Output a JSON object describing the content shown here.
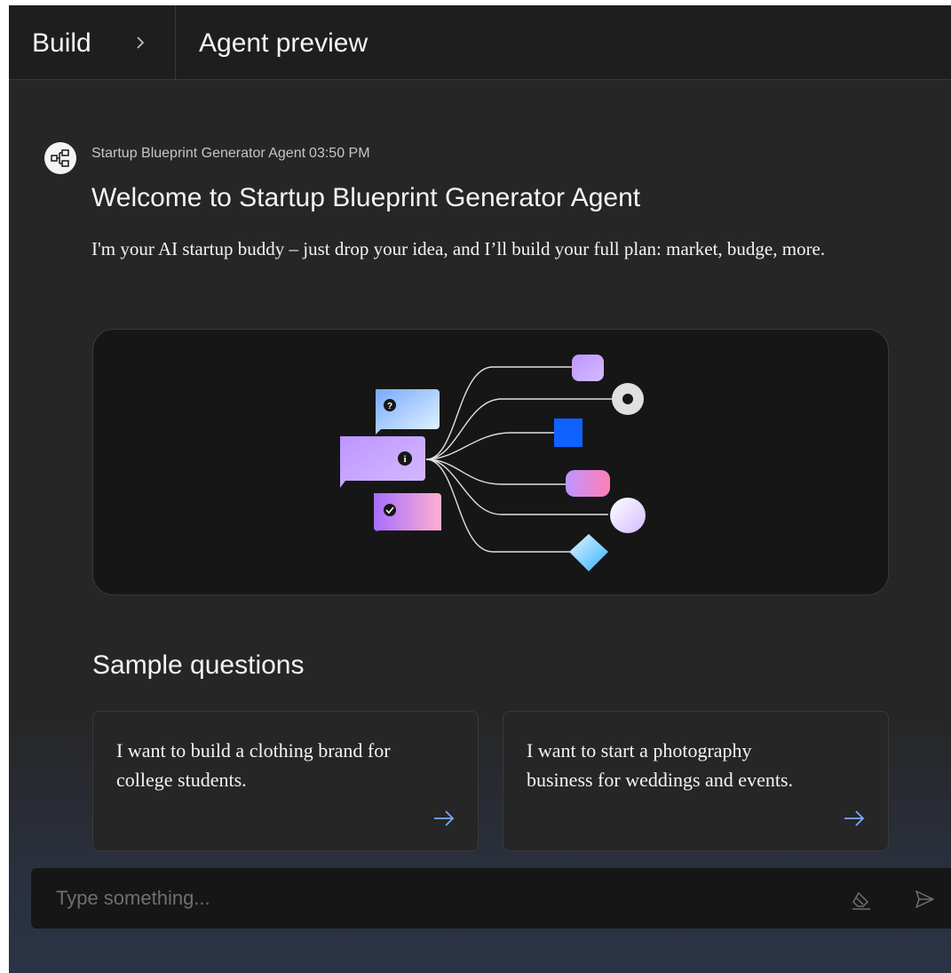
{
  "header": {
    "breadcrumb_root": "Build",
    "title": "Agent preview"
  },
  "message": {
    "sender": "Startup Blueprint Generator Agent",
    "time": "03:50 PM",
    "title": "Welcome to Startup Blueprint Generator Agent",
    "text": "I'm your AI startup buddy – just drop your idea, and I’ll build your full plan: market, budge, more."
  },
  "samples": {
    "title": "Sample questions",
    "questions": [
      "I want to build a clothing brand for college students.",
      "I want to start a photography business for weddings and events."
    ]
  },
  "input": {
    "placeholder": "Type something..."
  },
  "icons": {
    "avatar": "workflow-icon",
    "chevron": "chevron-right-icon",
    "arrow": "arrow-right-icon",
    "eraser": "eraser-icon",
    "send": "send-icon"
  },
  "colors": {
    "accent": "#78a9ff",
    "blue": "#0f62fe",
    "purple": "#be95ff",
    "cyan": "#bae6ff",
    "pink": "#ffafd2"
  }
}
